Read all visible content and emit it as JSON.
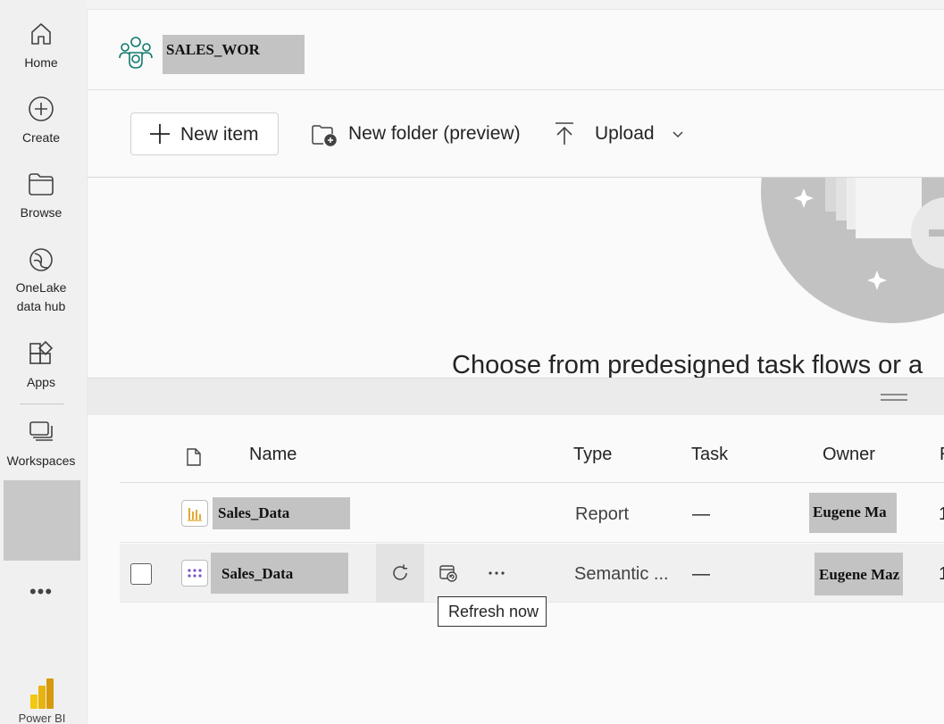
{
  "nav": {
    "items": [
      {
        "label": "Home",
        "icon": "home-icon"
      },
      {
        "label": "Create",
        "icon": "plus-circle-icon"
      },
      {
        "label": "Browse",
        "icon": "folder-icon"
      },
      {
        "label": "OneLake data hub",
        "line1": "OneLake",
        "line2": "data hub",
        "icon": "onelake-icon"
      },
      {
        "label": "Apps",
        "icon": "apps-icon"
      },
      {
        "label": "Workspaces",
        "icon": "workspaces-icon"
      }
    ],
    "more": "•••",
    "brand": "Power BI"
  },
  "workspace": {
    "name": "SALES_WOR",
    "icon": "people-group-icon",
    "accent": "#0f7b6c"
  },
  "toolbar": {
    "new_item": "New item",
    "new_folder": "New folder (preview)",
    "upload": "Upload"
  },
  "banner": {
    "title": "Choose from predesigned task flows or a"
  },
  "table": {
    "columns": [
      "Name",
      "Type",
      "Task",
      "Owner",
      "R"
    ],
    "rows": [
      {
        "name": "Sales_Data",
        "type": "Report",
        "task": "—",
        "owner": "Eugene Ma",
        "icon": "report-icon",
        "extra": "1"
      },
      {
        "name": "Sales_Data",
        "type": "Semantic ...",
        "task": "—",
        "owner": "Eugene Maz",
        "icon": "semantic-model-icon",
        "extra": "1"
      }
    ]
  },
  "tooltip": "Refresh now"
}
